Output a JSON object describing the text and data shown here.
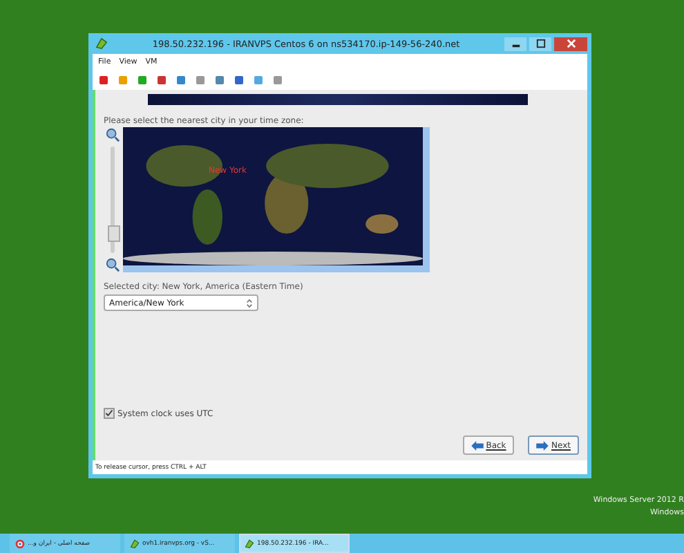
{
  "window": {
    "title": "198.50.232.196 - IRANVPS Centos 6 on ns534170.ip-149-56-240.net"
  },
  "menu": [
    "File",
    "View",
    "VM"
  ],
  "installer": {
    "zoom": {
      "level": 0.1
    },
    "prompt": "Please select the nearest city in your time zone:",
    "map_city": "New York",
    "selected_city": "Selected city: New York, America (Eastern Time)",
    "timezone": "America/New York",
    "utc": {
      "label": "System clock uses UTC",
      "checked": true
    },
    "buttons": [
      {
        "label": "Back",
        "kind": "back"
      },
      {
        "label": "Next",
        "kind": "next"
      }
    ]
  },
  "status_bar": "To release cursor, press CTRL + ALT",
  "desktop_text": [
    "Windows Server 2012 R",
    "Windows"
  ],
  "taskbar": [
    {
      "label": "صفحه اصلی - ایران و...",
      "kind": "browser",
      "selected": false
    },
    {
      "label": "ovh1.iranvps.org - vS...",
      "kind": "vsphere",
      "selected": false
    },
    {
      "label": "198.50.232.196 - IRA...",
      "kind": "vsphere",
      "selected": true
    }
  ]
}
